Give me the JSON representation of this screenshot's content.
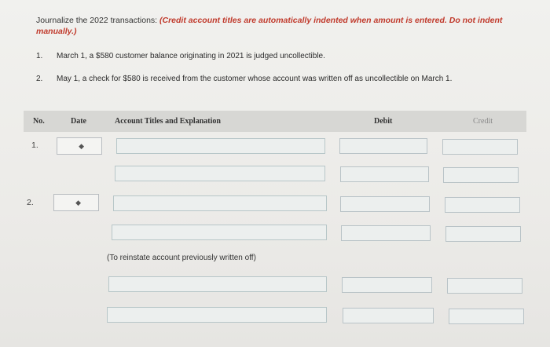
{
  "instructions": {
    "lead": "Journalize the 2022 transactions: ",
    "emphasis": "(Credit account titles are automatically indented when amount is entered. Do not indent manually.)"
  },
  "transactions": [
    {
      "num": "1.",
      "text": "March 1, a $580 customer balance originating in 2021 is judged uncollectible."
    },
    {
      "num": "2.",
      "text": "May 1, a check for $580 is received from the customer whose account was written off as uncollectible on March 1."
    }
  ],
  "table": {
    "headers": {
      "no": "No.",
      "date": "Date",
      "account": "Account Titles and Explanation",
      "debit": "Debit",
      "credit": "Credit"
    },
    "entries": [
      {
        "num": "1.",
        "date": "",
        "lines": [
          "",
          ""
        ]
      },
      {
        "num": "2.",
        "date": "",
        "lines": [
          "",
          ""
        ],
        "note": "(To reinstate account previously written off)",
        "lines_after_note": [
          "",
          ""
        ]
      }
    ]
  },
  "icons": {
    "date_picker": "chevron-updown-icon"
  }
}
